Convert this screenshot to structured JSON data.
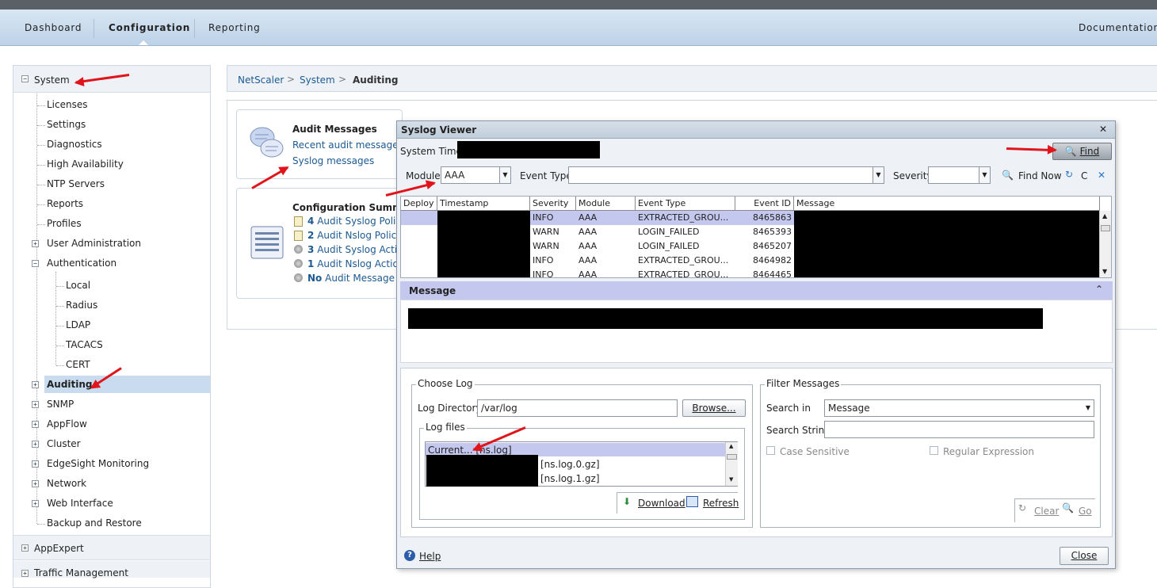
{
  "nav": {
    "tabs": [
      "Dashboard",
      "Configuration",
      "Reporting"
    ],
    "active_tab": "Configuration",
    "documentation": "Documentation"
  },
  "sidebar": {
    "system": "System",
    "items": [
      "Licenses",
      "Settings",
      "Diagnostics",
      "High Availability",
      "NTP Servers",
      "Reports",
      "Profiles",
      "User Administration",
      "Authentication"
    ],
    "auth_children": [
      "Local",
      "Radius",
      "LDAP",
      "TACACS",
      "CERT"
    ],
    "items2": [
      "Auditing",
      "SNMP",
      "AppFlow",
      "Cluster",
      "EdgeSight Monitoring",
      "Network",
      "Web Interface",
      "Backup and Restore"
    ],
    "appexpert": "AppExpert",
    "traffic": "Traffic Management",
    "toggle_collapsed": "+",
    "toggle_expanded": "−"
  },
  "breadcrumb": {
    "items": [
      "NetScaler",
      "System",
      "Auditing"
    ],
    "sep": ">"
  },
  "audit_panel": {
    "title": "Audit Messages",
    "recent": "Recent audit messages",
    "syslog": "Syslog messages"
  },
  "config_panel": {
    "title": "Configuration Summary",
    "rows": [
      {
        "count": "4",
        "text": "Audit Syslog Policie"
      },
      {
        "count": "2",
        "text": "Audit Nslog Policie"
      },
      {
        "count": "3",
        "text": "Audit Syslog Action"
      },
      {
        "count": "1",
        "text": "Audit Nslog Action"
      },
      {
        "count": "No",
        "text": "Audit Message Ac"
      }
    ]
  },
  "dialog": {
    "title": "Syslog Viewer",
    "close_x": "✕",
    "system_time_label": "System Time:",
    "find": "Find",
    "module_label": "Module",
    "module_value": "AAA",
    "event_type_label": "Event Type",
    "event_type_value": "",
    "severity_label": "Severity",
    "severity_value": "",
    "find_now": "Find Now",
    "clear_short": "C",
    "table": {
      "headers": [
        "Deploy",
        "Timestamp",
        "Severity",
        "Module",
        "Event Type",
        "Event ID",
        "Message"
      ],
      "rows": [
        {
          "severity": "INFO",
          "module": "AAA",
          "event_type": "EXTRACTED_GROU...",
          "event_id": "8465863"
        },
        {
          "severity": "WARN",
          "module": "AAA",
          "event_type": "LOGIN_FAILED",
          "event_id": "8465393"
        },
        {
          "severity": "WARN",
          "module": "AAA",
          "event_type": "LOGIN_FAILED",
          "event_id": "8465207"
        },
        {
          "severity": "INFO",
          "module": "AAA",
          "event_type": "EXTRACTED_GROU...",
          "event_id": "8464982"
        },
        {
          "severity": "INFO",
          "module": "AAA",
          "event_type": "EXTRACTED_GROU...",
          "event_id": "8464465"
        }
      ]
    },
    "message_label": "Message",
    "choose_log": {
      "title": "Choose Log",
      "dir_label": "Log Directory",
      "dir_value": "/var/log",
      "browse": "Browse...",
      "files_title": "Log files",
      "files": [
        "Current... [ns.log]",
        "[ns.log.0.gz]",
        "[ns.log.1.gz]"
      ],
      "download": "Download",
      "refresh": "Refresh"
    },
    "filter": {
      "title": "Filter Messages",
      "search_in_label": "Search in",
      "search_in_value": "Message",
      "search_string_label": "Search String",
      "search_string_value": "",
      "case_sensitive": "Case Sensitive",
      "regex": "Regular Expression",
      "clear": "Clear",
      "go": "Go"
    },
    "help": "Help",
    "close": "Close"
  },
  "colors": {
    "accent": "#1d5a92",
    "annotation_arrow": "#e0141a",
    "selection": "#c4c8ee"
  }
}
